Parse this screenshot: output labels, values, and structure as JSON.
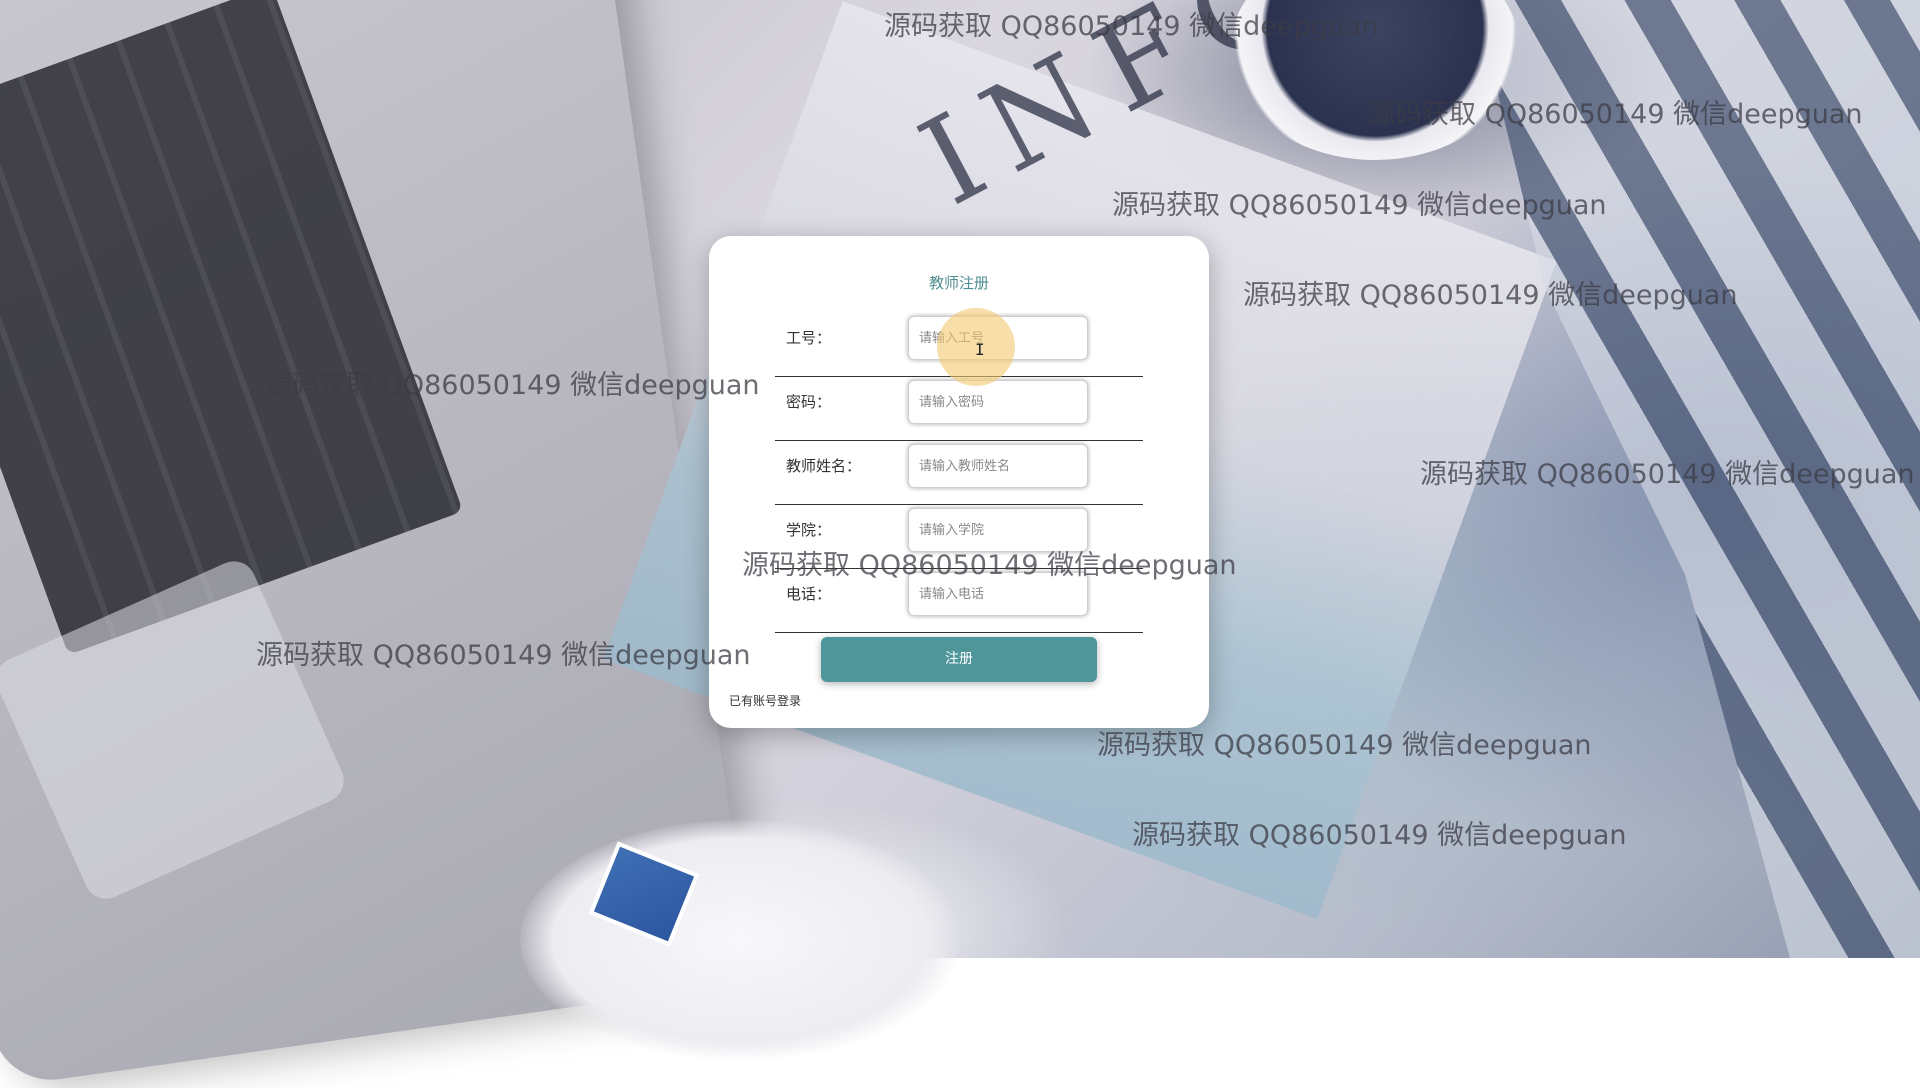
{
  "background": {
    "magazine_title": "INFO"
  },
  "form": {
    "title": "教师注册",
    "fields": [
      {
        "label": "工号：",
        "placeholder": "请输入工号"
      },
      {
        "label": "密码：",
        "placeholder": "请输入密码"
      },
      {
        "label": "教师姓名：",
        "placeholder": "请输入教师姓名"
      },
      {
        "label": "学院：",
        "placeholder": "请输入学院"
      },
      {
        "label": "电话：",
        "placeholder": "请输入电话"
      }
    ],
    "submit_label": "注册",
    "login_link": "已有账号登录",
    "accent_color": "#4f969a"
  },
  "watermark": {
    "text": "源码获取 QQ86050149 微信deepguan"
  },
  "cursor": {
    "icon": "text-cursor-icon"
  }
}
